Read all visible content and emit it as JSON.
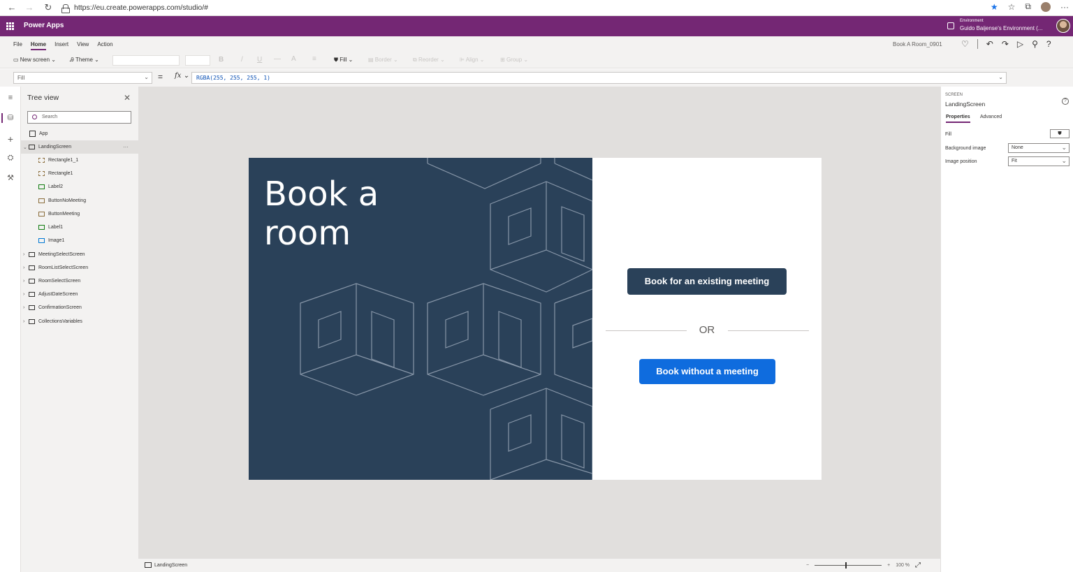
{
  "browser": {
    "url": "https://eu.create.powerapps.com/studio/#"
  },
  "header": {
    "app_name": "Power Apps",
    "environment_label": "Environment",
    "environment_name": "Guido Baijense's Environment (..."
  },
  "menu": {
    "items": [
      "File",
      "Home",
      "Insert",
      "View",
      "Action"
    ],
    "active": "Home",
    "app_title": "Book A Room_0901"
  },
  "ribbon": {
    "new_screen": "New screen",
    "theme": "Theme",
    "bold": "B",
    "italic": "/",
    "underline": "U",
    "fill": "Fill",
    "border": "Border",
    "reorder": "Reorder",
    "align": "Align",
    "group": "Group"
  },
  "formula_bar": {
    "property": "Fill",
    "equals": "=",
    "fx": "fx",
    "formula": "RGBA(255, 255, 255, 1)"
  },
  "tree_view": {
    "title": "Tree view",
    "search_placeholder": "Search",
    "app_item": "App",
    "screen_selected": "LandingScreen",
    "children": [
      "Rectangle1_1",
      "Rectangle1",
      "Label2",
      "ButtonNoMeeting",
      "ButtonMeeting",
      "Label1",
      "Image1"
    ],
    "other_screens": [
      "MeetingSelectScreen",
      "RoomListSelectScreen",
      "RoomSelectScreen",
      "AdjustDateScreen",
      "ConfirmationScreen",
      "CollectionsVariables"
    ],
    "more_options": "···"
  },
  "canvas": {
    "hero_title": "Book a room",
    "btn_existing": "Book for an existing meeting",
    "or_text": "OR",
    "btn_no_meeting": "Book without a meeting",
    "colors": {
      "hero_bg": "#2a4159",
      "primary_button": "#0f6cde",
      "secondary_button": "#2a4159"
    }
  },
  "status_bar": {
    "screen_name": "LandingScreen",
    "zoom_minus": "−",
    "zoom_plus": "+",
    "zoom_level": "100 %"
  },
  "properties_panel": {
    "category": "SCREEN",
    "name": "LandingScreen",
    "tabs": [
      "Properties",
      "Advanced"
    ],
    "fill_label": "Fill",
    "background_image_label": "Background image",
    "background_image_value": "None",
    "image_position_label": "Image position",
    "image_position_value": "Fit"
  },
  "colors": {
    "brand_purple": "#742774"
  }
}
